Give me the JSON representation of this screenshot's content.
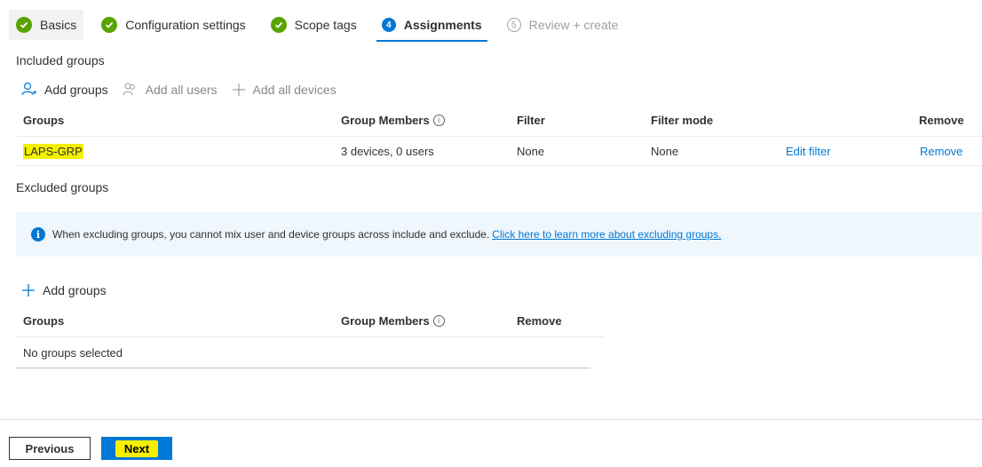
{
  "steps": [
    {
      "label": "Basics",
      "state": "done"
    },
    {
      "label": "Configuration settings",
      "state": "done"
    },
    {
      "label": "Scope tags",
      "state": "done"
    },
    {
      "label": "Assignments",
      "state": "current",
      "number": "4"
    },
    {
      "label": "Review + create",
      "state": "pending",
      "number": "5"
    }
  ],
  "included": {
    "title": "Included groups",
    "actions": {
      "add_groups": "Add groups",
      "add_all_users": "Add all users",
      "add_all_devices": "Add all devices"
    },
    "columns": {
      "groups": "Groups",
      "members": "Group Members",
      "filter": "Filter",
      "filter_mode": "Filter mode",
      "remove": "Remove"
    },
    "rows": [
      {
        "group": "LAPS-GRP",
        "members": "3 devices, 0 users",
        "filter": "None",
        "filter_mode": "None",
        "edit_filter": "Edit filter",
        "remove": "Remove"
      }
    ]
  },
  "excluded": {
    "title": "Excluded groups",
    "info_text": "When excluding groups, you cannot mix user and device groups across include and exclude.",
    "info_link": "Click here to learn more about excluding groups.",
    "add_groups": "Add groups",
    "columns": {
      "groups": "Groups",
      "members": "Group Members",
      "remove": "Remove"
    },
    "empty": "No groups selected"
  },
  "footer": {
    "previous": "Previous",
    "next": "Next"
  },
  "colors": {
    "accent": "#0078d4",
    "success": "#57a300",
    "highlight": "#f4f000",
    "info_bg": "#eff6fc"
  }
}
